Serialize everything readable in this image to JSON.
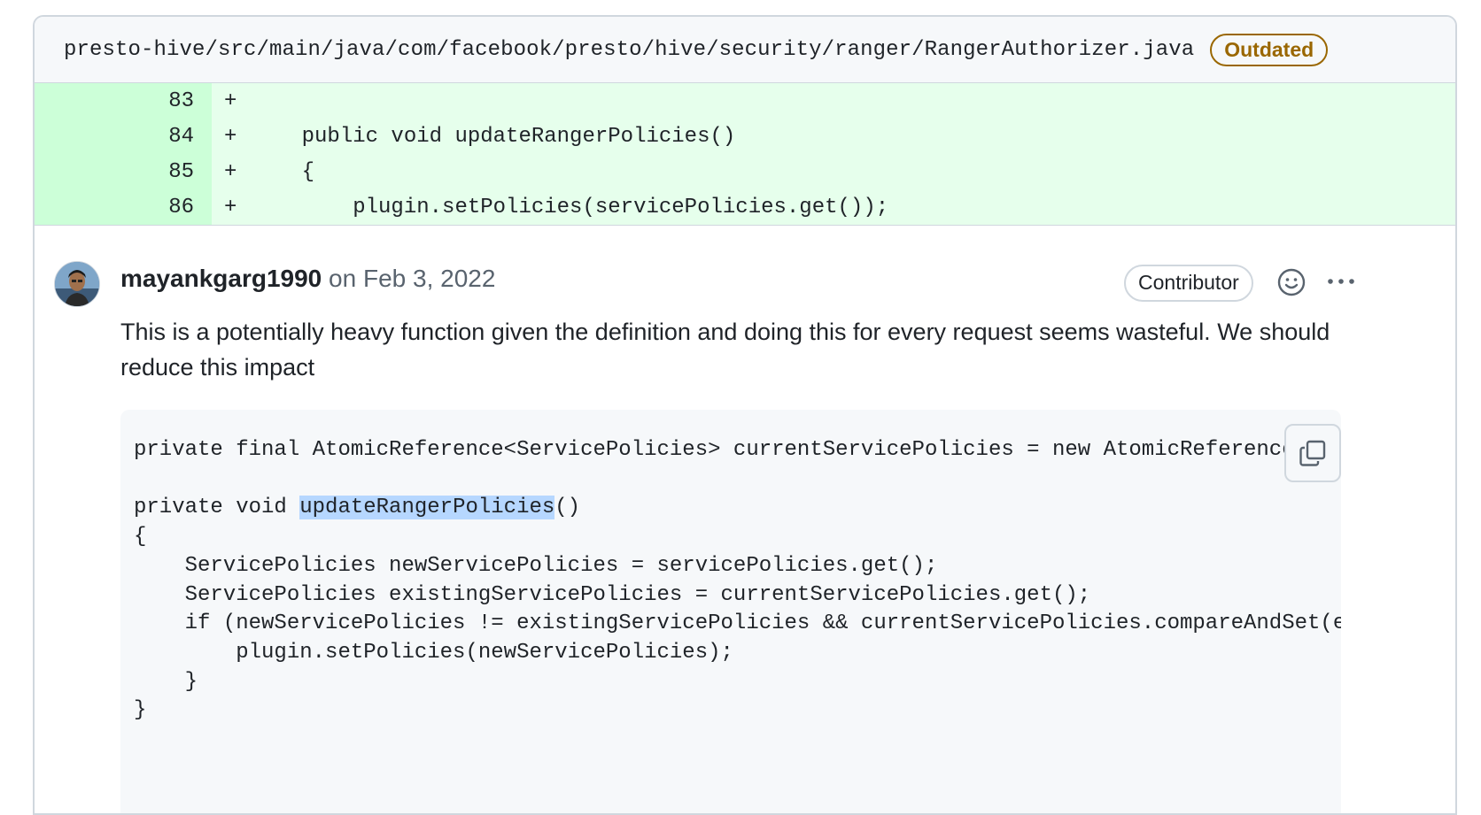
{
  "file": {
    "path": "presto-hive/src/main/java/com/facebook/presto/hive/security/ranger/RangerAuthorizer.java",
    "badge": "Outdated"
  },
  "diff": {
    "lines": [
      {
        "num": "83",
        "sign": "+",
        "code": ""
      },
      {
        "num": "84",
        "sign": "+",
        "code": "    public void updateRangerPolicies()"
      },
      {
        "num": "85",
        "sign": "+",
        "code": "    {"
      },
      {
        "num": "86",
        "sign": "+",
        "code": "        plugin.setPolicies(servicePolicies.get());"
      }
    ]
  },
  "comment": {
    "author": "mayankgarg1990",
    "date": "on Feb 3, 2022",
    "role_badge": "Contributor",
    "reaction_icon": "smiley-icon",
    "more_icon": "kebab-horizontal-icon",
    "body": "This is a potentially heavy function given the definition and doing this for every request seems wasteful. We should reduce this impact",
    "code": {
      "line1": "private final AtomicReference<ServicePolicies> currentServicePolicies = new AtomicReference<>();",
      "line2_prefix": "private void ",
      "line2_highlight": "updateRangerPolicies",
      "line2_suffix": "()",
      "rest": "{\n    ServicePolicies newServicePolicies = servicePolicies.get();\n    ServicePolicies existingServicePolicies = currentServicePolicies.get();\n    if (newServicePolicies != existingServicePolicies && currentServicePolicies.compareAndSet(existingServicePolicies, newServicePolicies)) {\n        plugin.setPolicies(newServicePolicies);\n    }\n}",
      "copy_icon": "copy-icon"
    }
  }
}
